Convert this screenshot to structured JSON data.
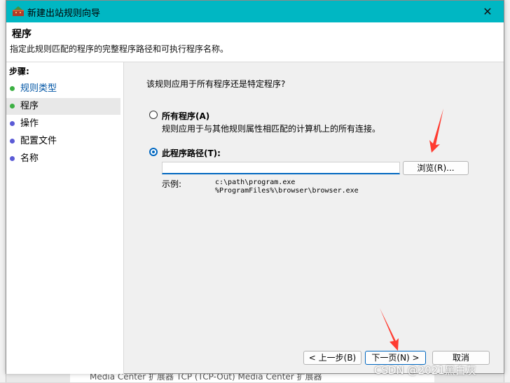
{
  "window": {
    "title": "新建出站规则向导",
    "close_symbol": "✕",
    "accent_color": "#00b7c3"
  },
  "header": {
    "title": "程序",
    "description": "指定此规则匹配的程序的完整程序路径和可执行程序名称。"
  },
  "sidebar": {
    "steps_label": "步骤:",
    "items": [
      {
        "label": "规则类型",
        "dot_color": "#3cb043",
        "link": true
      },
      {
        "label": "程序",
        "dot_color": "#3cb043",
        "link": false
      },
      {
        "label": "操作",
        "dot_color": "#5b5bd6",
        "link": false
      },
      {
        "label": "配置文件",
        "dot_color": "#5b5bd6",
        "link": false
      },
      {
        "label": "名称",
        "dot_color": "#5b5bd6",
        "link": false
      }
    ]
  },
  "main": {
    "question": "该规则应用于所有程序还是特定程序?",
    "option_all": {
      "label": "所有程序(A)",
      "description": "规则应用于与其他规则属性相匹配的计算机上的所有连接。"
    },
    "option_path": {
      "label": "此程序路径(T):",
      "value": ""
    },
    "browse_label": "浏览(R)...",
    "example_label": "示例:",
    "example_lines": [
      "c:\\path\\program.exe",
      "%ProgramFiles%\\browser\\browser.exe"
    ]
  },
  "footer": {
    "back_label": "< 上一步(B)",
    "next_label": "下一页(N) >",
    "cancel_label": "取消"
  },
  "background": {
    "bottom_row_text": "Media Center 扩展器  TCP (TCP-Out)  Media Center 扩展器"
  },
  "watermark": "CSDN @2021黑白灰"
}
